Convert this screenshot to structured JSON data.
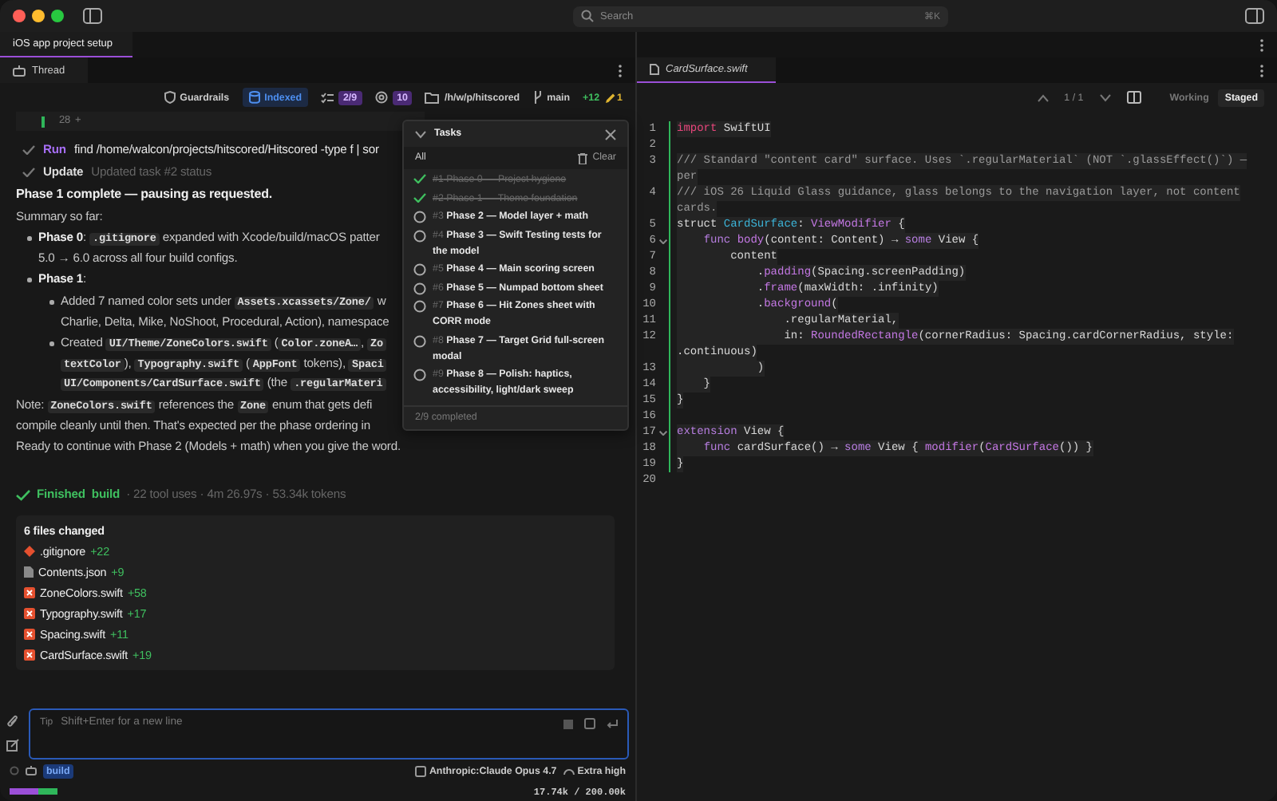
{
  "window": {
    "search_placeholder": "Search",
    "search_shortcut": "⌘K"
  },
  "left_tabs": [
    {
      "label": "iOS app project setup",
      "selected": true
    }
  ],
  "thread_tab": {
    "label": "Thread"
  },
  "toolbar": {
    "guardrails": "Guardrails",
    "indexed": "Indexed",
    "tasks_count": "2/9",
    "files_count": "10",
    "path": "/h/w/p/hitscored",
    "branch": "main",
    "added": "+12",
    "edited": "1"
  },
  "diff_marker": {
    "count": "28",
    "sign": "+"
  },
  "steps": [
    {
      "kind": "run",
      "label": "Run",
      "text": "find /home/walcon/projects/hitscored/Hitscored -type f | sor"
    },
    {
      "kind": "update",
      "label": "Update",
      "text": "Updated task #2 status"
    }
  ],
  "message": [
    {
      "kind": "heading",
      "lines": [
        [
          {
            "kind": "text",
            "text": "Phase 1 complete — pausing as requested."
          }
        ]
      ]
    },
    {
      "kind": "para",
      "lines": [
        [
          {
            "kind": "text",
            "text": "Summary so far:"
          }
        ]
      ]
    },
    {
      "kind": "bullet",
      "lines": [
        [
          {
            "kind": "bold",
            "text": "Phase 0"
          },
          {
            "kind": "text",
            "text": ": "
          },
          {
            "kind": "code",
            "text": ".gitignore"
          },
          {
            "kind": "text",
            "text": " expanded with Xcode/build/macOS patter"
          }
        ],
        [
          {
            "kind": "text",
            "text": "5.0 → 6.0 across all four build configs."
          }
        ]
      ]
    },
    {
      "kind": "bullet",
      "lines": [
        [
          {
            "kind": "bold",
            "text": "Phase 1"
          },
          {
            "kind": "text",
            "text": ":"
          }
        ]
      ]
    },
    {
      "kind": "subbullet",
      "lines": [
        [
          {
            "kind": "text",
            "text": "Added 7 named color sets under "
          },
          {
            "kind": "code",
            "text": "Assets.xcassets/Zone/"
          },
          {
            "kind": "text",
            "text": " w"
          }
        ],
        [
          {
            "kind": "text",
            "text": "Charlie, Delta, Mike, NoShoot, Procedural, Action), namespace"
          }
        ]
      ]
    },
    {
      "kind": "subbullet",
      "lines": [
        [
          {
            "kind": "text",
            "text": "Created "
          },
          {
            "kind": "code",
            "text": "UI/Theme/ZoneColors.swift"
          },
          {
            "kind": "text",
            "text": " ("
          },
          {
            "kind": "code",
            "text": "Color.zoneA…"
          },
          {
            "kind": "text",
            "text": ", "
          },
          {
            "kind": "code",
            "text": "Zo"
          }
        ],
        [
          {
            "kind": "code",
            "text": "textColor"
          },
          {
            "kind": "text",
            "text": "), "
          },
          {
            "kind": "code",
            "text": "Typography.swift"
          },
          {
            "kind": "text",
            "text": " ("
          },
          {
            "kind": "code",
            "text": "AppFont"
          },
          {
            "kind": "text",
            "text": " tokens), "
          },
          {
            "kind": "code",
            "text": "Spaci"
          }
        ],
        [
          {
            "kind": "code",
            "text": "UI/Components/CardSurface.swift"
          },
          {
            "kind": "text",
            "text": " (the "
          },
          {
            "kind": "code",
            "text": ".regularMateri"
          }
        ]
      ]
    },
    {
      "kind": "para",
      "lines": [
        [
          {
            "kind": "text",
            "text": "Note: "
          },
          {
            "kind": "code",
            "text": "ZoneColors.swift"
          },
          {
            "kind": "text",
            "text": " references the "
          },
          {
            "kind": "code",
            "text": "Zone"
          },
          {
            "kind": "text",
            "text": " enum that gets defi"
          }
        ],
        [
          {
            "kind": "text",
            "text": "compile cleanly until then. That's expected per the phase ordering in"
          }
        ]
      ]
    },
    {
      "kind": "para",
      "lines": [
        [
          {
            "kind": "text",
            "text": "Ready to continue with Phase 2 (Models + math) when you give the word."
          }
        ]
      ]
    }
  ],
  "tasks_popup": {
    "title": "Tasks",
    "filter": "All",
    "clear": "Clear",
    "footer": "2/9 completed",
    "items": [
      {
        "number": "#1",
        "title": "Phase 0 — Project hygiene",
        "done": true
      },
      {
        "number": "#2",
        "title": "Phase 1 — Theme foundation",
        "done": true
      },
      {
        "number": "#3",
        "title": "Phase 2 — Model layer + math",
        "done": false
      },
      {
        "number": "#4",
        "title": "Phase 3 — Swift Testing tests for the model",
        "done": false
      },
      {
        "number": "#5",
        "title": "Phase 4 — Main scoring screen",
        "done": false
      },
      {
        "number": "#6",
        "title": "Phase 5 — Numpad bottom sheet",
        "done": false
      },
      {
        "number": "#7",
        "title": "Phase 6 — Hit Zones sheet with CORR mode",
        "done": false
      },
      {
        "number": "#8",
        "title": "Phase 7 — Target Grid full-screen modal",
        "done": false
      },
      {
        "number": "#9",
        "title": "Phase 8 — Polish: haptics, accessibility, light/dark sweep",
        "done": false
      }
    ]
  },
  "finished": {
    "status": "Finished",
    "agent": "build",
    "stats": "· 22 tool uses · 4m 26.97s · 53.34k tokens"
  },
  "changes": {
    "title": "6 files changed",
    "files": [
      {
        "name": ".gitignore",
        "kind": "git",
        "added": "+22"
      },
      {
        "name": "Contents.json",
        "kind": "json",
        "added": "+9"
      },
      {
        "name": "ZoneColors.swift",
        "kind": "swift",
        "added": "+58"
      },
      {
        "name": "Typography.swift",
        "kind": "swift",
        "added": "+17"
      },
      {
        "name": "Spacing.swift",
        "kind": "swift",
        "added": "+11"
      },
      {
        "name": "CardSurface.swift",
        "kind": "swift",
        "added": "+19"
      }
    ]
  },
  "composer": {
    "tip": "Tip",
    "placeholder": "Shift+Enter for a new line",
    "agent": "build",
    "model": "Anthropic:Claude Opus 4.7",
    "effort": "Extra high",
    "context": "17.74k / 200.00k"
  },
  "editor": {
    "tab": {
      "label": "CardSurface.swift",
      "selected": true
    },
    "hunk": "1 / 1",
    "modes": [
      {
        "label": "Working",
        "selected": false
      },
      {
        "label": "Staged",
        "selected": true
      }
    ],
    "lines": [
      {
        "number": "1",
        "changed": true,
        "fold": false,
        "rows": [
          [
            {
              "kind": "kw",
              "text": "import"
            },
            {
              "kind": "plain",
              "text": " SwiftUI"
            }
          ]
        ]
      },
      {
        "number": "2",
        "changed": true,
        "fold": false
      },
      {
        "number": "3",
        "changed": true,
        "fold": false,
        "rows": [
          [
            {
              "kind": "com",
              "text": "/// Standard \"content card\" surface. Uses `.regularMaterial` (NOT `.glassEffect()`) —"
            }
          ],
          [
            {
              "kind": "com",
              "text": "per"
            }
          ]
        ]
      },
      {
        "number": "4",
        "changed": true,
        "fold": false,
        "rows": [
          [
            {
              "kind": "com",
              "text": "/// iOS 26 Liquid Glass guidance, glass belongs to the navigation layer, not content"
            }
          ],
          [
            {
              "kind": "com",
              "text": "cards."
            }
          ]
        ]
      },
      {
        "number": "5",
        "changed": true,
        "fold": false,
        "rows": [
          [
            {
              "kind": "plain",
              "text": "struct "
            },
            {
              "kind": "type",
              "text": "CardSurface"
            },
            {
              "kind": "plain",
              "text": ": "
            },
            {
              "kind": "fn",
              "text": "ViewModifier"
            },
            {
              "kind": "plain",
              "text": " {"
            }
          ]
        ]
      },
      {
        "number": "6",
        "changed": true,
        "fold": true,
        "rows": [
          [
            {
              "kind": "plain",
              "text": "    "
            },
            {
              "kind": "key",
              "text": "func"
            },
            {
              "kind": "plain",
              "text": " "
            },
            {
              "kind": "fn",
              "text": "body"
            },
            {
              "kind": "plain",
              "text": "(content: Content) → "
            },
            {
              "kind": "key",
              "text": "some"
            },
            {
              "kind": "plain",
              "text": " View {"
            }
          ]
        ]
      },
      {
        "number": "7",
        "changed": true,
        "fold": false,
        "rows": [
          [
            {
              "kind": "plain",
              "text": "        content"
            }
          ]
        ]
      },
      {
        "number": "8",
        "changed": true,
        "fold": false,
        "rows": [
          [
            {
              "kind": "plain",
              "text": "            ."
            },
            {
              "kind": "fn",
              "text": "padding"
            },
            {
              "kind": "plain",
              "text": "(Spacing.screenPadding)"
            }
          ]
        ]
      },
      {
        "number": "9",
        "changed": true,
        "fold": false,
        "rows": [
          [
            {
              "kind": "plain",
              "text": "            ."
            },
            {
              "kind": "fn",
              "text": "frame"
            },
            {
              "kind": "plain",
              "text": "(maxWidth: .infinity)"
            }
          ]
        ]
      },
      {
        "number": "10",
        "changed": true,
        "fold": false,
        "rows": [
          [
            {
              "kind": "plain",
              "text": "            ."
            },
            {
              "kind": "fn",
              "text": "background"
            },
            {
              "kind": "plain",
              "text": "("
            }
          ]
        ]
      },
      {
        "number": "11",
        "changed": true,
        "fold": false,
        "rows": [
          [
            {
              "kind": "plain",
              "text": "                .regularMaterial,"
            }
          ]
        ]
      },
      {
        "number": "12",
        "changed": true,
        "fold": false,
        "rows": [
          [
            {
              "kind": "plain",
              "text": "                in: "
            },
            {
              "kind": "fn",
              "text": "RoundedRectangle"
            },
            {
              "kind": "plain",
              "text": "(cornerRadius: Spacing.cardCornerRadius, style:"
            }
          ],
          [
            {
              "kind": "plain",
              "text": ".continuous)"
            }
          ]
        ]
      },
      {
        "number": "13",
        "changed": true,
        "fold": false,
        "rows": [
          [
            {
              "kind": "plain",
              "text": "            )"
            }
          ]
        ]
      },
      {
        "number": "14",
        "changed": true,
        "fold": false,
        "rows": [
          [
            {
              "kind": "plain",
              "text": "    }"
            }
          ]
        ]
      },
      {
        "number": "15",
        "changed": true,
        "fold": false,
        "rows": [
          [
            {
              "kind": "plain",
              "text": "}"
            }
          ]
        ]
      },
      {
        "number": "16",
        "changed": true,
        "fold": false
      },
      {
        "number": "17",
        "changed": true,
        "fold": true,
        "rows": [
          [
            {
              "kind": "key",
              "text": "extension"
            },
            {
              "kind": "plain",
              "text": " View {"
            }
          ]
        ]
      },
      {
        "number": "18",
        "changed": true,
        "fold": false,
        "rows": [
          [
            {
              "kind": "plain",
              "text": "    "
            },
            {
              "kind": "key",
              "text": "func"
            },
            {
              "kind": "plain",
              "text": " cardSurface() → "
            },
            {
              "kind": "key",
              "text": "some"
            },
            {
              "kind": "plain",
              "text": " View { "
            },
            {
              "kind": "fn",
              "text": "modifier"
            },
            {
              "kind": "plain",
              "text": "("
            },
            {
              "kind": "fn",
              "text": "CardSurface"
            },
            {
              "kind": "plain",
              "text": "()) }"
            }
          ]
        ]
      },
      {
        "number": "19",
        "changed": true,
        "fold": false,
        "rows": [
          [
            {
              "kind": "plain",
              "text": "}"
            }
          ]
        ]
      },
      {
        "number": "20",
        "changed": false,
        "fold": false
      }
    ]
  }
}
